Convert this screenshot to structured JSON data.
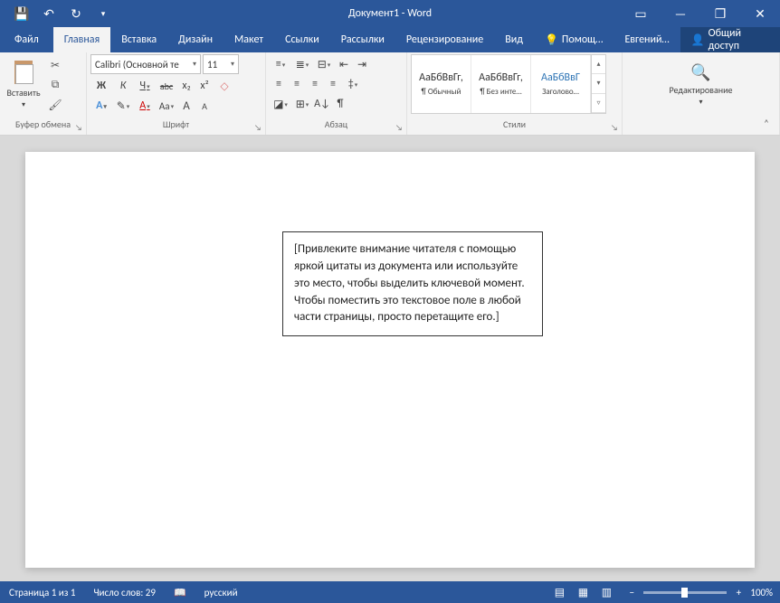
{
  "titlebar": {
    "title": "Документ1 - Word"
  },
  "tabs": {
    "file": "Файл",
    "items": [
      "Главная",
      "Вставка",
      "Дизайн",
      "Макет",
      "Ссылки",
      "Рассылки",
      "Рецензирование",
      "Вид"
    ],
    "active_index": 0,
    "help": "Помощ…",
    "user": "Евгений…",
    "share": "Общий доступ"
  },
  "ribbon": {
    "clipboard": {
      "label": "Буфер обмена",
      "paste": "Вставить"
    },
    "font": {
      "label": "Шрифт",
      "name": "Calibri (Основной те",
      "size": "11",
      "bold": "Ж",
      "italic": "К",
      "underline": "Ч",
      "strike": "abc",
      "sub": "x₂",
      "sup": "x²"
    },
    "paragraph": {
      "label": "Абзац"
    },
    "styles": {
      "label": "Стили",
      "items": [
        {
          "preview": "АаБбВвГг,",
          "name": "¶ Обычный"
        },
        {
          "preview": "АаБбВвГг,",
          "name": "¶ Без инте…"
        },
        {
          "preview": "АаБбВвГ",
          "name": "Заголово…"
        }
      ]
    },
    "editing": {
      "label": "Редактирование"
    }
  },
  "document": {
    "textbox": "[Привлеките внимание читателя с помощью яркой цитаты из документа или используйте это место, чтобы выделить ключевой момент. Чтобы поместить это текстовое поле в любой части страницы, просто перетащите его.]"
  },
  "statusbar": {
    "page": "Страница 1 из 1",
    "words": "Число слов: 29",
    "language": "русский",
    "zoom": "100%"
  }
}
